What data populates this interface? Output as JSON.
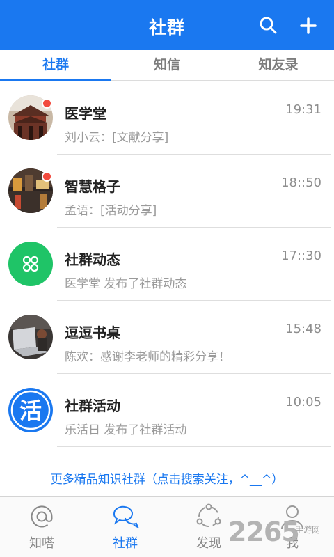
{
  "header": {
    "title": "社群",
    "search_icon": "search-icon",
    "add_icon": "plus-icon"
  },
  "tabs": [
    {
      "label": "社群",
      "active": true
    },
    {
      "label": "知信",
      "active": false
    },
    {
      "label": "知友录",
      "active": false
    }
  ],
  "conversations": [
    {
      "name": "医学堂",
      "preview": "刘小云：[文献分享]",
      "time": "19:31",
      "unread": true,
      "avatar": "pagoda-photo"
    },
    {
      "name": "智慧格子",
      "preview": "孟语：[活动分享]",
      "time": "18::50",
      "unread": true,
      "avatar": "street-night-photo"
    },
    {
      "name": "社群动态",
      "preview": "医学堂 发布了社群动态",
      "time": "17::30",
      "unread": false,
      "avatar": "clover-icon"
    },
    {
      "name": "逗逗书桌",
      "preview": "陈欢：感谢李老师的精彩分享！",
      "time": "15:48",
      "unread": false,
      "avatar": "laptop-desk-photo"
    },
    {
      "name": "社群活动",
      "preview": "乐活日 发布了社群活动",
      "time": "10:05",
      "unread": false,
      "avatar": "huo-icon"
    }
  ],
  "huo_char": "活",
  "more_link": "更多精品知识社群（点击搜索关注，^__^）",
  "bottom_nav": [
    {
      "label": "知嗒",
      "icon": "at-icon",
      "active": false
    },
    {
      "label": "社群",
      "icon": "chat-bubbles-icon",
      "active": true
    },
    {
      "label": "发现",
      "icon": "discover-icon",
      "active": false
    },
    {
      "label": "我",
      "icon": "person-icon",
      "active": false
    }
  ],
  "watermark": {
    "number": "2265",
    "text": "手游网"
  },
  "colors": {
    "accent": "#1a78f0",
    "badge": "#f24b3f",
    "green": "#1fc467"
  }
}
